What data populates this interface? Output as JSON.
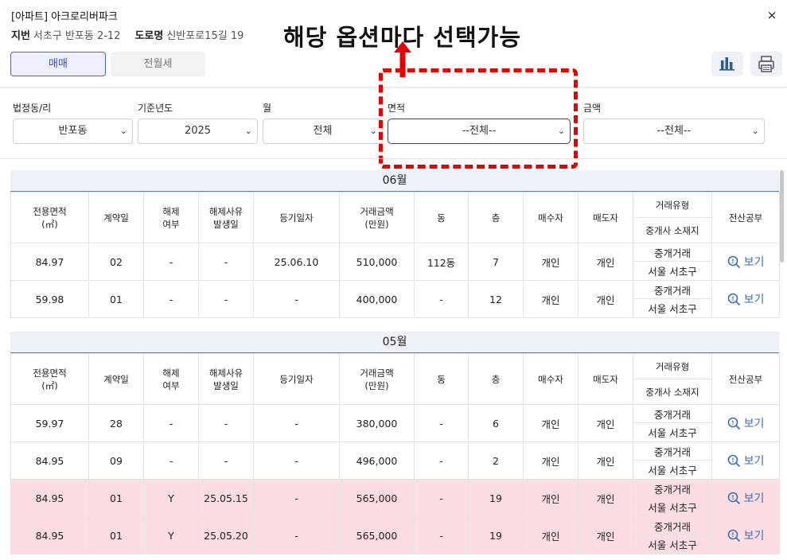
{
  "header": {
    "title": "[아파트] 아크로리버파크",
    "jibun_label": "지번",
    "jibun_value": "서초구 반포동 2-12",
    "road_label": "도로명",
    "road_value": "신반포로15길 19",
    "close_label": "×",
    "tabs": {
      "buy": "매매",
      "rent": "전월세"
    },
    "icons": {
      "chart": "bar-chart-icon",
      "print": "printer-icon"
    }
  },
  "annotation": {
    "text": "해당 옵션마다 선택가능",
    "color": "#e60000"
  },
  "filters": {
    "dong": {
      "label": "법정동/리",
      "value": "반포동"
    },
    "year": {
      "label": "기준년도",
      "value": "2025"
    },
    "month": {
      "label": "월",
      "value": "전체"
    },
    "area": {
      "label": "면적",
      "value": "--전체--"
    },
    "price": {
      "label": "금액",
      "value": "--전체--"
    }
  },
  "table_headers": {
    "area": "전용면적\n(㎡)",
    "day": "계약일",
    "cancel": "해제\n여부",
    "cancel_date": "해제사유\n발생일",
    "reg_date": "등기일자",
    "price": "거래금액\n(만원)",
    "dong": "동",
    "floor": "층",
    "buyer": "매수자",
    "seller": "매도자",
    "trade_type": "거래유형",
    "agent_loc": "중개사 소재지",
    "ledger": "전산공부"
  },
  "view_label": "보기",
  "sections": [
    {
      "month": "06월",
      "rows": [
        {
          "area": "84.97",
          "day": "02",
          "cancel": "-",
          "cancel_date": "-",
          "reg_date": "25.06.10",
          "price": "510,000",
          "dong": "112동",
          "floor": "7",
          "buyer": "개인",
          "seller": "개인",
          "trade_type": "중개거래",
          "agent_loc": "서울 서초구",
          "cancelled": false
        },
        {
          "area": "59.98",
          "day": "01",
          "cancel": "-",
          "cancel_date": "-",
          "reg_date": "-",
          "price": "400,000",
          "dong": "-",
          "floor": "12",
          "buyer": "개인",
          "seller": "개인",
          "trade_type": "중개거래",
          "agent_loc": "서울 서초구",
          "cancelled": false
        }
      ]
    },
    {
      "month": "05월",
      "rows": [
        {
          "area": "59.97",
          "day": "28",
          "cancel": "-",
          "cancel_date": "-",
          "reg_date": "-",
          "price": "380,000",
          "dong": "-",
          "floor": "6",
          "buyer": "개인",
          "seller": "개인",
          "trade_type": "중개거래",
          "agent_loc": "서울 서초구",
          "cancelled": false
        },
        {
          "area": "84.95",
          "day": "09",
          "cancel": "-",
          "cancel_date": "-",
          "reg_date": "-",
          "price": "496,000",
          "dong": "-",
          "floor": "2",
          "buyer": "개인",
          "seller": "개인",
          "trade_type": "중개거래",
          "agent_loc": "서울 서초구",
          "cancelled": false
        },
        {
          "area": "84.95",
          "day": "01",
          "cancel": "Y",
          "cancel_date": "25.05.15",
          "reg_date": "-",
          "price": "565,000",
          "dong": "-",
          "floor": "19",
          "buyer": "개인",
          "seller": "개인",
          "trade_type": "중개거래",
          "agent_loc": "서울 서초구",
          "cancelled": true
        },
        {
          "area": "84.95",
          "day": "01",
          "cancel": "Y",
          "cancel_date": "25.05.20",
          "reg_date": "-",
          "price": "565,000",
          "dong": "-",
          "floor": "19",
          "buyer": "개인",
          "seller": "개인",
          "trade_type": "중개거래",
          "agent_loc": "서울 서초구",
          "cancelled": true
        }
      ]
    }
  ],
  "colors": {
    "accent": "#4a5fc1",
    "cancelled_row": "#fbdde2",
    "link": "#3b70b8",
    "month_bar": "#edf1f8"
  }
}
